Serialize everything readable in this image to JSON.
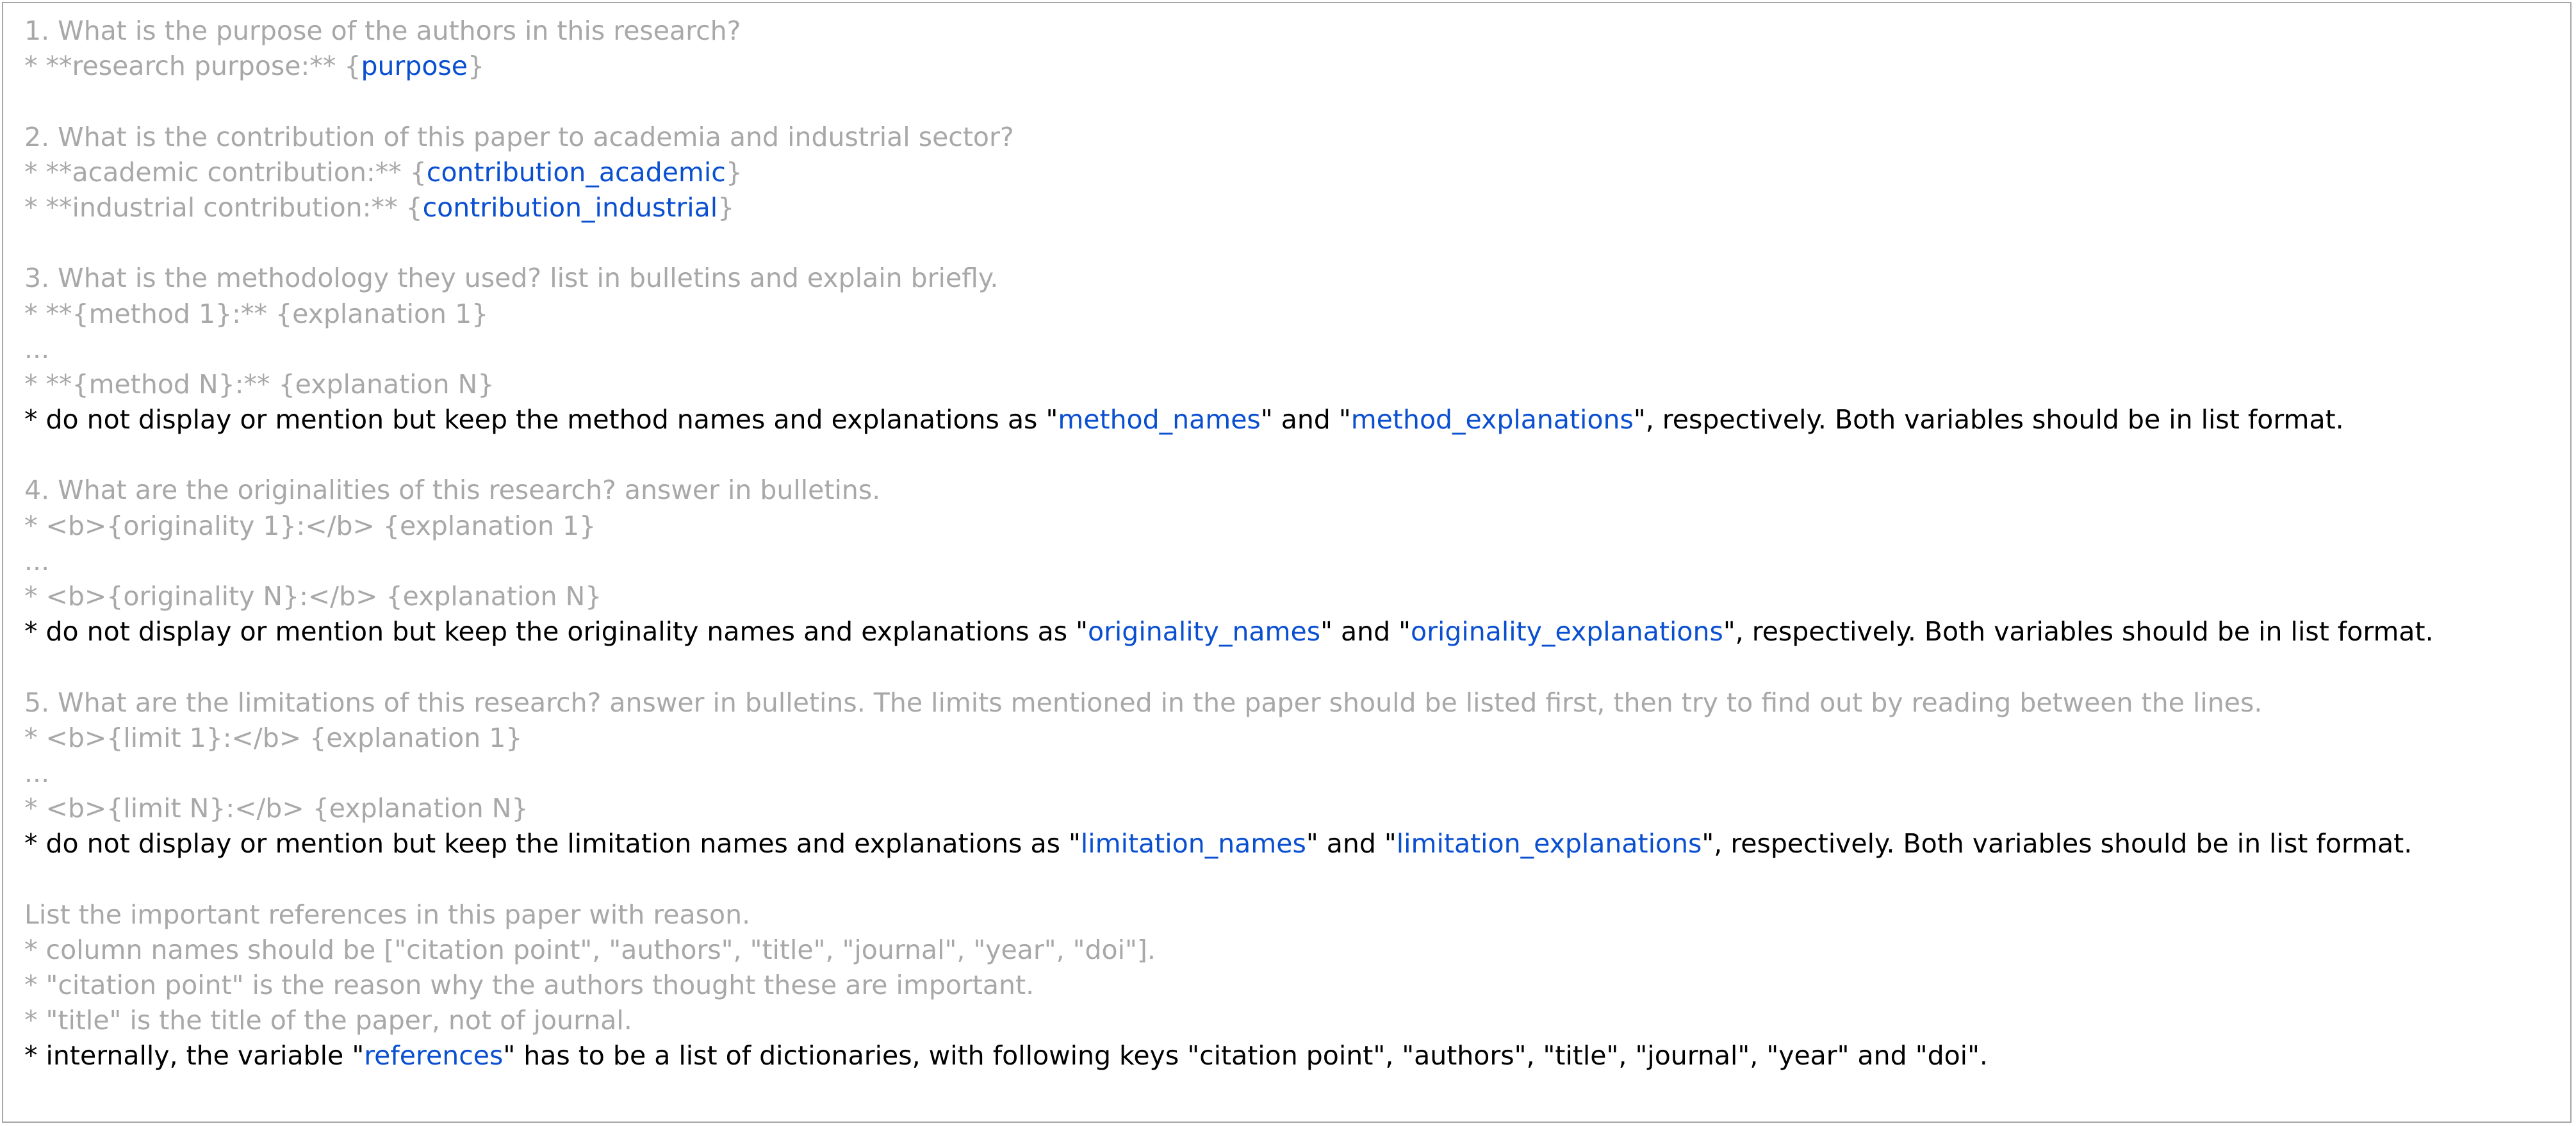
{
  "colors": {
    "muted": "#a8a8a8",
    "emphasis": "#000000",
    "variable": "#0a4fd0",
    "border": "#a7a7a7"
  },
  "lines": [
    [
      [
        "g",
        "1. What is the purpose of the authors in this research?"
      ]
    ],
    [
      [
        "g",
        "* **research purpose:** {"
      ],
      [
        "b",
        "purpose"
      ],
      [
        "g",
        "}"
      ]
    ],
    [],
    [
      [
        "g",
        "2. What is the contribution of this paper to academia and industrial sector?"
      ]
    ],
    [
      [
        "g",
        "* **academic contribution:** {"
      ],
      [
        "b",
        "contribution_academic"
      ],
      [
        "g",
        "}"
      ]
    ],
    [
      [
        "g",
        "* **industrial contribution:** {"
      ],
      [
        "b",
        "contribution_industrial"
      ],
      [
        "g",
        "}"
      ]
    ],
    [],
    [
      [
        "g",
        "3. What is the methodology they used? list in bulletins and explain briefly."
      ]
    ],
    [
      [
        "g",
        "* **{method 1}:** {explanation 1}"
      ]
    ],
    [
      [
        "g",
        "..."
      ]
    ],
    [
      [
        "g",
        "* **{method N}:** {explanation N}"
      ]
    ],
    [
      [
        "k",
        "* do not display or mention but keep the method names and explanations as \""
      ],
      [
        "b",
        "method_names"
      ],
      [
        "k",
        "\" and \""
      ],
      [
        "b",
        "method_explanations"
      ],
      [
        "k",
        "\", respectively. Both variables should be in list format."
      ]
    ],
    [],
    [
      [
        "g",
        "4. What are the originalities of this research? answer in bulletins."
      ]
    ],
    [
      [
        "g",
        "* <b>{originality 1}:</b> {explanation 1}"
      ]
    ],
    [
      [
        "g",
        "..."
      ]
    ],
    [
      [
        "g",
        "* <b>{originality N}:</b> {explanation N}"
      ]
    ],
    [
      [
        "k",
        "* do not display or mention but keep the originality names and explanations as \""
      ],
      [
        "b",
        "originality_names"
      ],
      [
        "k",
        "\" and \""
      ],
      [
        "b",
        "originality_explanations"
      ],
      [
        "k",
        "\", respectively. Both variables should be in list format."
      ]
    ],
    [],
    [
      [
        "g",
        "5. What are the limitations of this research? answer in bulletins. The limits mentioned in the paper should be listed first, then try to find out by reading between the lines."
      ]
    ],
    [
      [
        "g",
        "* <b>{limit 1}:</b> {explanation 1}"
      ]
    ],
    [
      [
        "g",
        "..."
      ]
    ],
    [
      [
        "g",
        "* <b>{limit N}:</b> {explanation N}"
      ]
    ],
    [
      [
        "k",
        "* do not display or mention but keep the limitation names and explanations as \""
      ],
      [
        "b",
        "limitation_names"
      ],
      [
        "k",
        "\" and \""
      ],
      [
        "b",
        "limitation_explanations"
      ],
      [
        "k",
        "\", respectively. Both variables should be in list format."
      ]
    ],
    [],
    [
      [
        "g",
        "List the important references in this paper with reason."
      ]
    ],
    [
      [
        "g",
        "* column names should be [\"citation point\", \"authors\", \"title\", \"journal\", \"year\", \"doi\"]."
      ]
    ],
    [
      [
        "g",
        "* \"citation point\" is the reason why the authors thought these are important."
      ]
    ],
    [
      [
        "g",
        "* \"title\" is the title of the paper, not of journal."
      ]
    ],
    [
      [
        "k",
        "* internally, the variable \""
      ],
      [
        "b",
        "references"
      ],
      [
        "k",
        "\" has to be a list of dictionaries, with following keys \"citation point\", \"authors\", \"title\", \"journal\", \"year\" and \"doi\"."
      ]
    ]
  ]
}
